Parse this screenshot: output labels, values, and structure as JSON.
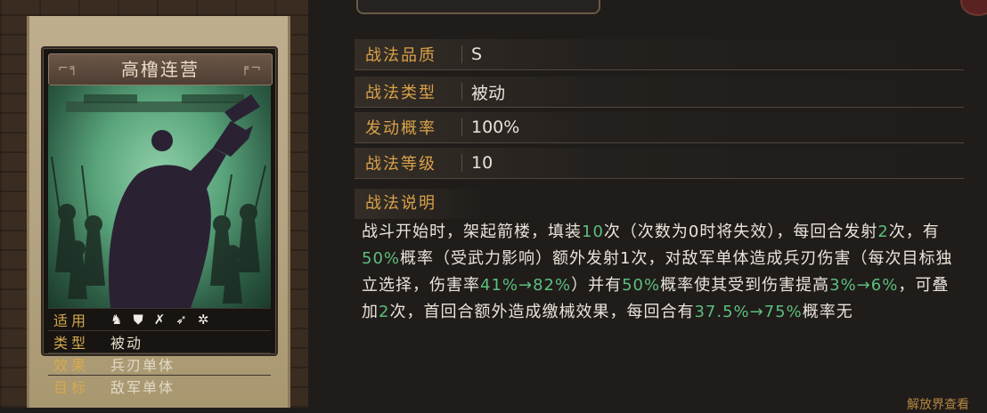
{
  "card": {
    "name": "高橹连营",
    "stats": [
      {
        "key": "适用",
        "value": ""
      },
      {
        "key": "类型",
        "value": "被动"
      },
      {
        "key": "效果",
        "value": "兵刃单体"
      },
      {
        "key": "目标",
        "value": "敌军单体"
      }
    ],
    "applicable_icons": [
      "cavalry-icon",
      "shield-icon",
      "bow-icon",
      "spear-icon",
      "wheel-icon"
    ]
  },
  "info": {
    "quality_label": "战法品质",
    "quality": "S",
    "type_label": "战法类型",
    "type": "被动",
    "rate_label": "发动概率",
    "rate": "100%",
    "level_label": "战法等级",
    "level": "10"
  },
  "description": {
    "heading": "战法说明",
    "segments": [
      {
        "t": "战斗开始时，架起箭楼，填装",
        "hl": false
      },
      {
        "t": "10",
        "hl": true
      },
      {
        "t": "次（次数为0时将失效），每回合发射",
        "hl": false
      },
      {
        "t": "2",
        "hl": true
      },
      {
        "t": "次，有",
        "hl": false
      },
      {
        "t": "50%",
        "hl": true
      },
      {
        "t": "概率（受武力影响）额外发射1次，对敌军单体造成兵刃伤害（每次目标独立选择，伤害率",
        "hl": false
      },
      {
        "t": "41%→82%",
        "hl": true
      },
      {
        "t": "）并有",
        "hl": false
      },
      {
        "t": "50%",
        "hl": true
      },
      {
        "t": "概率使其受到伤害提高",
        "hl": false
      },
      {
        "t": "3%→6%",
        "hl": true
      },
      {
        "t": "，可叠加",
        "hl": false
      },
      {
        "t": "2",
        "hl": true
      },
      {
        "t": "次，首回合额外造成缴械效果，每回合有",
        "hl": false
      },
      {
        "t": "37.5%→75%",
        "hl": true
      },
      {
        "t": "概率无",
        "hl": false
      }
    ],
    "more_hint": "解放界查看"
  },
  "colors": {
    "accent": "#d9a24a",
    "highlight": "#5cbf7d",
    "text": "#e9e4da"
  }
}
